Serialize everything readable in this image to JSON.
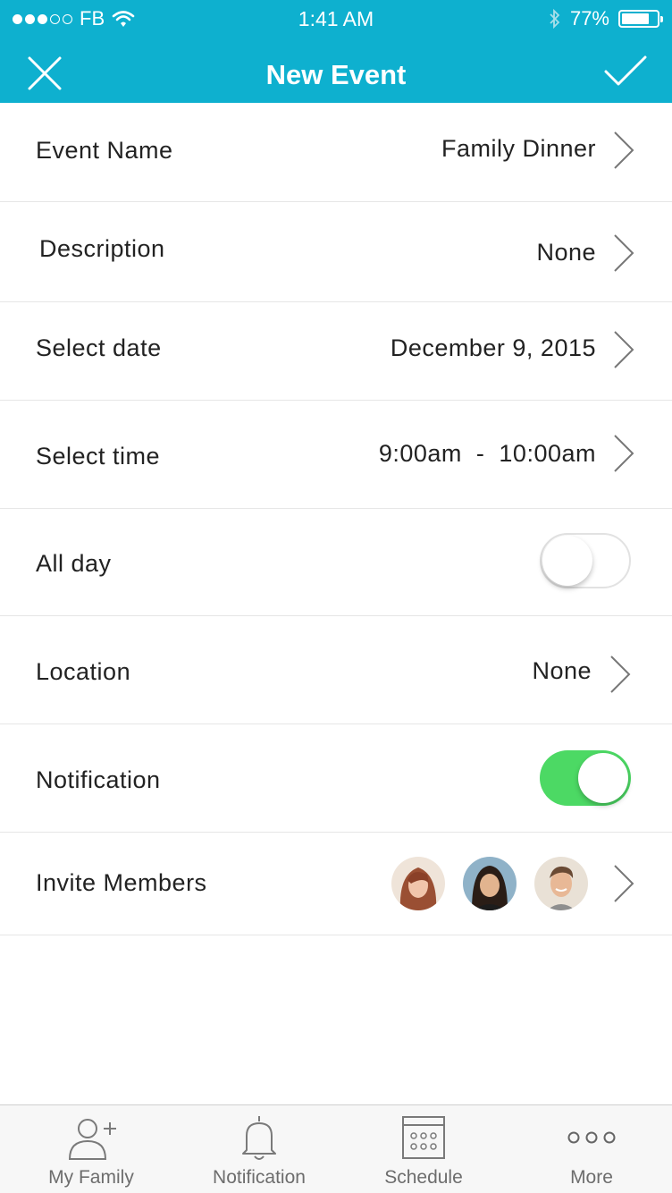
{
  "status_bar": {
    "carrier": "FB",
    "time": "1:41 AM",
    "battery": "77%",
    "battery_level": 0.77
  },
  "nav": {
    "title": "New Event",
    "close_icon": "close-icon",
    "confirm_icon": "checkmark-icon"
  },
  "rows": {
    "event_name": {
      "label": "Event Name",
      "value": "Family Dinner"
    },
    "description": {
      "label": "Description",
      "value": "None"
    },
    "date": {
      "label": "Select date",
      "value": "December 9, 2015"
    },
    "time": {
      "label": "Select time",
      "value": "9:00am  -  10:00am"
    },
    "all_day": {
      "label": "All day",
      "on": false
    },
    "location": {
      "label": "Location",
      "value": "None"
    },
    "notification": {
      "label": "Notification",
      "on": true
    },
    "invite": {
      "label": "Invite Members",
      "members": [
        "member-1-avatar",
        "member-2-avatar",
        "member-3-avatar"
      ]
    }
  },
  "tabbar": {
    "items": [
      {
        "label": "My Family",
        "icon": "add-person-icon"
      },
      {
        "label": "Notification",
        "icon": "bell-icon"
      },
      {
        "label": "Schedule",
        "icon": "calendar-icon"
      },
      {
        "label": "More",
        "icon": "more-dots-icon"
      }
    ]
  },
  "colors": {
    "accent": "#0eb0cf",
    "toggle_on": "#4cd964",
    "divider": "#e6e6e6"
  }
}
